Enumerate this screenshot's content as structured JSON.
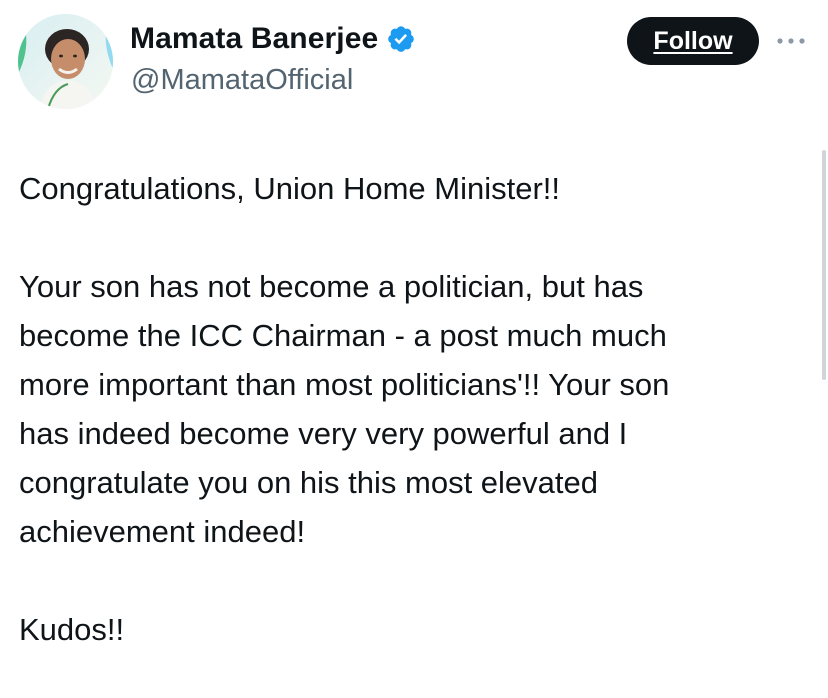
{
  "author": {
    "display_name": "Mamata Banerjee",
    "handle": "@MamataOfficial",
    "avatar": "profile-photo",
    "verified_icon": "verified-badge-icon"
  },
  "actions": {
    "follow_label": "Follow",
    "more_icon": "more-options-icon"
  },
  "tweet": {
    "paragraphs": [
      [
        "Congratulations, Union Home Minister!!"
      ],
      [
        "Your son has not become a politician, but has",
        "become the ICC Chairman - a post much much",
        "more important than most politicians'!!  Your son",
        "has indeed become very very powerful and I",
        "congratulate you on his this most elevated",
        "achievement indeed!"
      ],
      [
        "Kudos!!"
      ]
    ]
  },
  "colors": {
    "text": "#0f1419",
    "secondary_text": "#536471",
    "verified_blue": "#1d9bf0",
    "button_bg": "#0f1419"
  }
}
